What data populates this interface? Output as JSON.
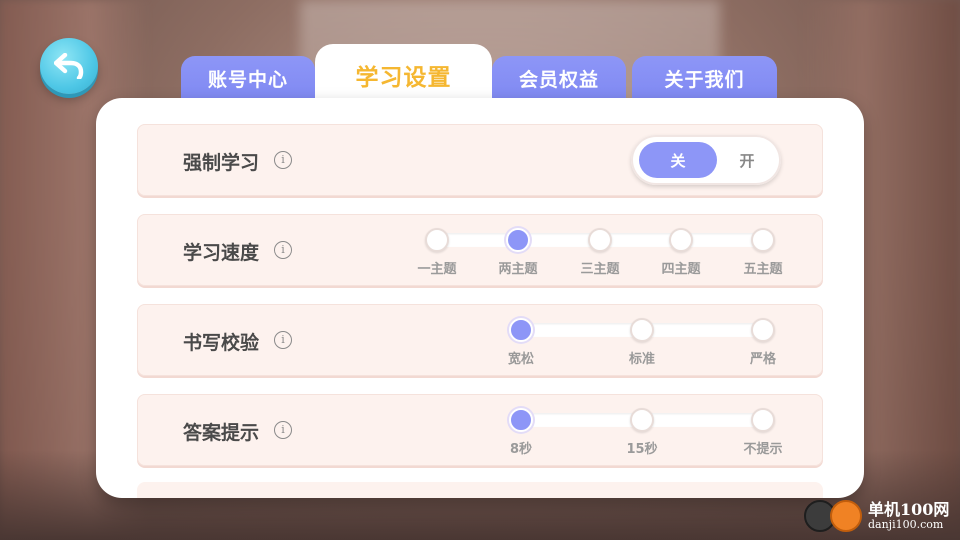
{
  "tabs": [
    {
      "label": "账号中心",
      "active": false
    },
    {
      "label": "学习设置",
      "active": true
    },
    {
      "label": "会员权益",
      "active": false
    },
    {
      "label": "关于我们",
      "active": false
    }
  ],
  "settings": {
    "forced_study": {
      "label": "强制学习",
      "info": "i",
      "toggle_selected": "关",
      "toggle_other": "开"
    },
    "speed": {
      "label": "学习速度",
      "info": "i",
      "options": [
        "一主题",
        "两主题",
        "三主题",
        "四主题",
        "五主题"
      ],
      "selected_index": 1
    },
    "writing_check": {
      "label": "书写校验",
      "info": "i",
      "options": [
        "宽松",
        "标准",
        "严格"
      ],
      "selected_index": 0
    },
    "answer_hint": {
      "label": "答案提示",
      "info": "i",
      "options": [
        "8秒",
        "15秒",
        "不提示"
      ],
      "selected_index": 0
    }
  },
  "icons": {
    "back": "back-arrow-icon"
  },
  "colors": {
    "accent": "#8d96f7",
    "active_tab_text": "#f5b731",
    "back_button": "#4ec7e6",
    "row_bg": "#fdf2ee"
  },
  "watermark": {
    "title": "单机100网",
    "url": "danji100.com"
  }
}
